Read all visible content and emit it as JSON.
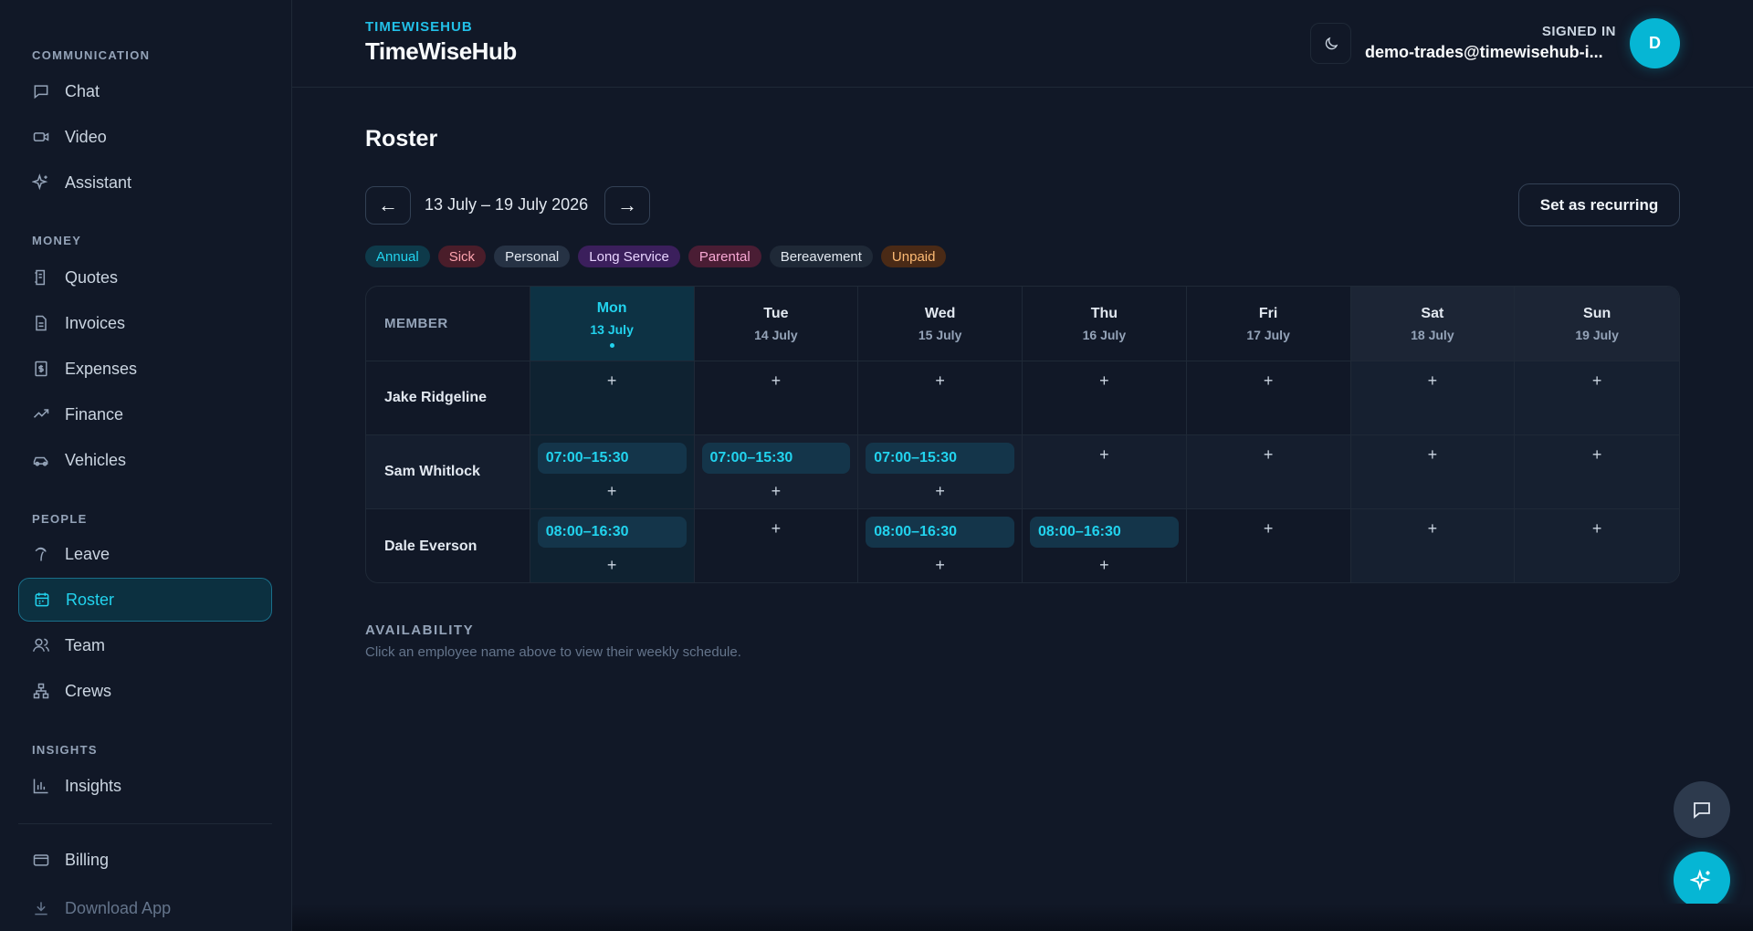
{
  "sidebar": {
    "sections": [
      {
        "title": "COMMUNICATION",
        "items": [
          {
            "label": "Chat",
            "icon": "chat-icon"
          },
          {
            "label": "Video",
            "icon": "video-icon"
          },
          {
            "label": "Assistant",
            "icon": "sparkles-icon"
          }
        ]
      },
      {
        "title": "MONEY",
        "items": [
          {
            "label": "Quotes",
            "icon": "quote-icon"
          },
          {
            "label": "Invoices",
            "icon": "invoice-icon"
          },
          {
            "label": "Expenses",
            "icon": "dollar-doc-icon"
          },
          {
            "label": "Finance",
            "icon": "trend-icon"
          },
          {
            "label": "Vehicles",
            "icon": "car-icon"
          }
        ]
      },
      {
        "title": "PEOPLE",
        "items": [
          {
            "label": "Leave",
            "icon": "palm-tree-icon"
          },
          {
            "label": "Roster",
            "icon": "calendar-icon",
            "active": true
          },
          {
            "label": "Team",
            "icon": "users-icon"
          },
          {
            "label": "Crews",
            "icon": "hierarchy-icon"
          }
        ]
      },
      {
        "title": "INSIGHTS",
        "items": [
          {
            "label": "Insights",
            "icon": "bar-chart-icon"
          }
        ]
      }
    ],
    "footer": [
      {
        "label": "Billing",
        "icon": "credit-card-icon"
      },
      {
        "label": "Download App",
        "icon": "download-icon"
      }
    ]
  },
  "header": {
    "brand_small": "TIMEWISEHUB",
    "brand_big": "TimeWiseHub",
    "signed_in_label": "SIGNED IN",
    "user_email": "demo-trades@timewisehub-i...",
    "avatar_initial": "D"
  },
  "roster": {
    "title": "Roster",
    "prev_label": "←",
    "next_label": "→",
    "week_label": "13 July – 19 July 2026",
    "recurring_label": "Set as recurring",
    "legend": [
      {
        "label": "Annual",
        "bg": "#0e3a4a",
        "fg": "#22d3ee"
      },
      {
        "label": "Sick",
        "bg": "#4a1d2a",
        "fg": "#fda4af"
      },
      {
        "label": "Personal",
        "bg": "#263244",
        "fg": "#e2e8f0"
      },
      {
        "label": "Long Service",
        "bg": "#3b1f5c",
        "fg": "#e9d5ff"
      },
      {
        "label": "Parental",
        "bg": "#4a1d34",
        "fg": "#f9a8d4"
      },
      {
        "label": "Bereavement",
        "bg": "#1f2937",
        "fg": "#e2e8f0"
      },
      {
        "label": "Unpaid",
        "bg": "#4a2a16",
        "fg": "#fdba74"
      }
    ],
    "member_header": "MEMBER",
    "days": [
      {
        "name": "Mon",
        "date": "13 July",
        "today": true
      },
      {
        "name": "Tue",
        "date": "14 July"
      },
      {
        "name": "Wed",
        "date": "15 July"
      },
      {
        "name": "Thu",
        "date": "16 July"
      },
      {
        "name": "Fri",
        "date": "17 July"
      },
      {
        "name": "Sat",
        "date": "18 July",
        "weekend": true
      },
      {
        "name": "Sun",
        "date": "19 July",
        "weekend": true
      }
    ],
    "members": [
      {
        "name": "Jake Ridgeline",
        "shifts": [
          "",
          "",
          "",
          "",
          "",
          "",
          ""
        ]
      },
      {
        "name": "Sam Whitlock",
        "shifts": [
          "07:00–15:30",
          "07:00–15:30",
          "07:00–15:30",
          "",
          "",
          "",
          ""
        ]
      },
      {
        "name": "Dale Everson",
        "shifts": [
          "08:00–16:30",
          "",
          "08:00–16:30",
          "08:00–16:30",
          "",
          "",
          ""
        ]
      }
    ],
    "add_symbol": "+"
  },
  "availability": {
    "title": "AVAILABILITY",
    "subtitle": "Click an employee name above to view their weekly schedule."
  },
  "colors": {
    "accent": "#06b6d4",
    "background": "#111827"
  }
}
